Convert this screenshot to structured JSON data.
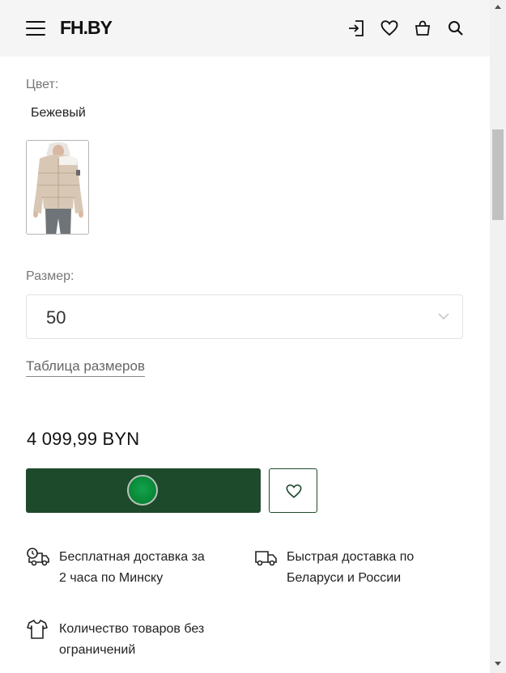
{
  "header": {
    "logo": "FH.BY",
    "icons": [
      "menu-icon",
      "login-icon",
      "heart-icon",
      "bag-icon",
      "search-icon"
    ]
  },
  "product": {
    "color_label": "Цвет:",
    "color_value": "Бежевый",
    "size_label": "Размер:",
    "size_value": "50",
    "size_table_link": "Таблица размеров",
    "price": "4 099,99 BYN"
  },
  "features": [
    {
      "icon": "fast-delivery-icon",
      "line1": "Бесплатная доставка за",
      "line2": "2 часа по Минску"
    },
    {
      "icon": "truck-icon",
      "line1": "Быстрая доставка по",
      "line2": "Беларуси и России"
    },
    {
      "icon": "tshirt-icon",
      "line1": "Количество товаров без",
      "line2": "ограничений"
    }
  ],
  "colors": {
    "header_bg": "#f5f5f5",
    "buy_button": "#1e4a2c",
    "buy_indicator": "#0a8a39"
  }
}
